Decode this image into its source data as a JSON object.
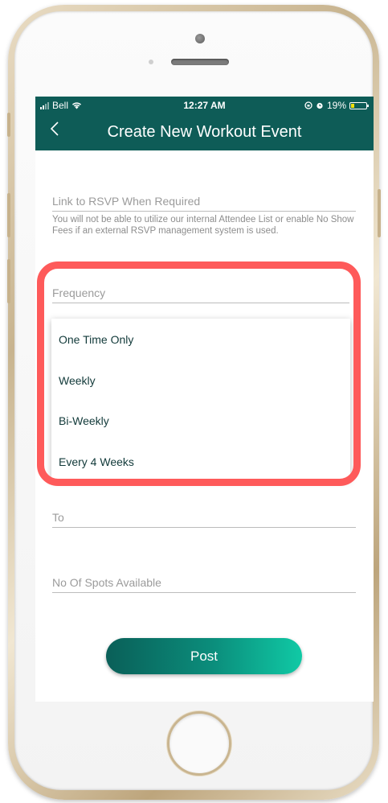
{
  "status": {
    "carrier": "Bell",
    "time": "12:27 AM",
    "battery": "19%",
    "battery_color": "#f1e10b"
  },
  "nav": {
    "back_icon": "chevron-left-icon",
    "title": "Create New Workout Event"
  },
  "form": {
    "rsvp_link_placeholder": "Link to RSVP When Required",
    "rsvp_hint": "You will not be able to utilize our internal Attendee List or enable No Show Fees if an external RSVP management system is used.",
    "frequency_placeholder": "Frequency",
    "frequency_options": [
      "One Time Only",
      "Weekly",
      "Bi-Weekly",
      "Every 4 Weeks"
    ],
    "to_placeholder": "To",
    "spots_placeholder": "No Of Spots Available",
    "post_label": "Post"
  },
  "colors": {
    "header": "#0e5c57",
    "highlight": "#fe5a5a",
    "button_start": "#0a5f58",
    "button_end": "#10c9a5"
  }
}
